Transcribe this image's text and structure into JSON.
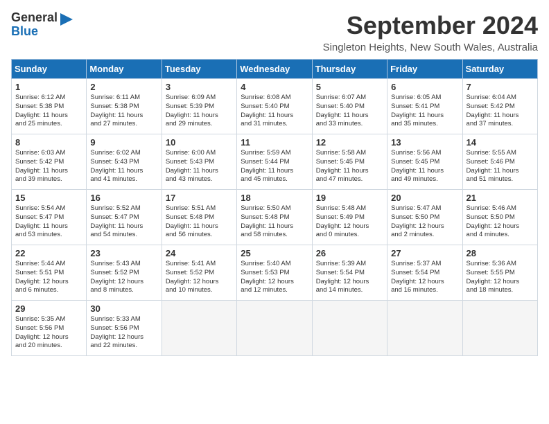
{
  "header": {
    "logo_line1": "General",
    "logo_line2": "Blue",
    "month": "September 2024",
    "location": "Singleton Heights, New South Wales, Australia"
  },
  "days_of_week": [
    "Sunday",
    "Monday",
    "Tuesday",
    "Wednesday",
    "Thursday",
    "Friday",
    "Saturday"
  ],
  "weeks": [
    [
      {
        "day": "1",
        "lines": [
          "Sunrise: 6:12 AM",
          "Sunset: 5:38 PM",
          "Daylight: 11 hours",
          "and 25 minutes."
        ]
      },
      {
        "day": "2",
        "lines": [
          "Sunrise: 6:11 AM",
          "Sunset: 5:38 PM",
          "Daylight: 11 hours",
          "and 27 minutes."
        ]
      },
      {
        "day": "3",
        "lines": [
          "Sunrise: 6:09 AM",
          "Sunset: 5:39 PM",
          "Daylight: 11 hours",
          "and 29 minutes."
        ]
      },
      {
        "day": "4",
        "lines": [
          "Sunrise: 6:08 AM",
          "Sunset: 5:40 PM",
          "Daylight: 11 hours",
          "and 31 minutes."
        ]
      },
      {
        "day": "5",
        "lines": [
          "Sunrise: 6:07 AM",
          "Sunset: 5:40 PM",
          "Daylight: 11 hours",
          "and 33 minutes."
        ]
      },
      {
        "day": "6",
        "lines": [
          "Sunrise: 6:05 AM",
          "Sunset: 5:41 PM",
          "Daylight: 11 hours",
          "and 35 minutes."
        ]
      },
      {
        "day": "7",
        "lines": [
          "Sunrise: 6:04 AM",
          "Sunset: 5:42 PM",
          "Daylight: 11 hours",
          "and 37 minutes."
        ]
      }
    ],
    [
      {
        "day": "8",
        "lines": [
          "Sunrise: 6:03 AM",
          "Sunset: 5:42 PM",
          "Daylight: 11 hours",
          "and 39 minutes."
        ]
      },
      {
        "day": "9",
        "lines": [
          "Sunrise: 6:02 AM",
          "Sunset: 5:43 PM",
          "Daylight: 11 hours",
          "and 41 minutes."
        ]
      },
      {
        "day": "10",
        "lines": [
          "Sunrise: 6:00 AM",
          "Sunset: 5:43 PM",
          "Daylight: 11 hours",
          "and 43 minutes."
        ]
      },
      {
        "day": "11",
        "lines": [
          "Sunrise: 5:59 AM",
          "Sunset: 5:44 PM",
          "Daylight: 11 hours",
          "and 45 minutes."
        ]
      },
      {
        "day": "12",
        "lines": [
          "Sunrise: 5:58 AM",
          "Sunset: 5:45 PM",
          "Daylight: 11 hours",
          "and 47 minutes."
        ]
      },
      {
        "day": "13",
        "lines": [
          "Sunrise: 5:56 AM",
          "Sunset: 5:45 PM",
          "Daylight: 11 hours",
          "and 49 minutes."
        ]
      },
      {
        "day": "14",
        "lines": [
          "Sunrise: 5:55 AM",
          "Sunset: 5:46 PM",
          "Daylight: 11 hours",
          "and 51 minutes."
        ]
      }
    ],
    [
      {
        "day": "15",
        "lines": [
          "Sunrise: 5:54 AM",
          "Sunset: 5:47 PM",
          "Daylight: 11 hours",
          "and 53 minutes."
        ]
      },
      {
        "day": "16",
        "lines": [
          "Sunrise: 5:52 AM",
          "Sunset: 5:47 PM",
          "Daylight: 11 hours",
          "and 54 minutes."
        ]
      },
      {
        "day": "17",
        "lines": [
          "Sunrise: 5:51 AM",
          "Sunset: 5:48 PM",
          "Daylight: 11 hours",
          "and 56 minutes."
        ]
      },
      {
        "day": "18",
        "lines": [
          "Sunrise: 5:50 AM",
          "Sunset: 5:48 PM",
          "Daylight: 11 hours",
          "and 58 minutes."
        ]
      },
      {
        "day": "19",
        "lines": [
          "Sunrise: 5:48 AM",
          "Sunset: 5:49 PM",
          "Daylight: 12 hours",
          "and 0 minutes."
        ]
      },
      {
        "day": "20",
        "lines": [
          "Sunrise: 5:47 AM",
          "Sunset: 5:50 PM",
          "Daylight: 12 hours",
          "and 2 minutes."
        ]
      },
      {
        "day": "21",
        "lines": [
          "Sunrise: 5:46 AM",
          "Sunset: 5:50 PM",
          "Daylight: 12 hours",
          "and 4 minutes."
        ]
      }
    ],
    [
      {
        "day": "22",
        "lines": [
          "Sunrise: 5:44 AM",
          "Sunset: 5:51 PM",
          "Daylight: 12 hours",
          "and 6 minutes."
        ]
      },
      {
        "day": "23",
        "lines": [
          "Sunrise: 5:43 AM",
          "Sunset: 5:52 PM",
          "Daylight: 12 hours",
          "and 8 minutes."
        ]
      },
      {
        "day": "24",
        "lines": [
          "Sunrise: 5:41 AM",
          "Sunset: 5:52 PM",
          "Daylight: 12 hours",
          "and 10 minutes."
        ]
      },
      {
        "day": "25",
        "lines": [
          "Sunrise: 5:40 AM",
          "Sunset: 5:53 PM",
          "Daylight: 12 hours",
          "and 12 minutes."
        ]
      },
      {
        "day": "26",
        "lines": [
          "Sunrise: 5:39 AM",
          "Sunset: 5:54 PM",
          "Daylight: 12 hours",
          "and 14 minutes."
        ]
      },
      {
        "day": "27",
        "lines": [
          "Sunrise: 5:37 AM",
          "Sunset: 5:54 PM",
          "Daylight: 12 hours",
          "and 16 minutes."
        ]
      },
      {
        "day": "28",
        "lines": [
          "Sunrise: 5:36 AM",
          "Sunset: 5:55 PM",
          "Daylight: 12 hours",
          "and 18 minutes."
        ]
      }
    ],
    [
      {
        "day": "29",
        "lines": [
          "Sunrise: 5:35 AM",
          "Sunset: 5:56 PM",
          "Daylight: 12 hours",
          "and 20 minutes."
        ]
      },
      {
        "day": "30",
        "lines": [
          "Sunrise: 5:33 AM",
          "Sunset: 5:56 PM",
          "Daylight: 12 hours",
          "and 22 minutes."
        ]
      },
      {
        "day": "",
        "lines": []
      },
      {
        "day": "",
        "lines": []
      },
      {
        "day": "",
        "lines": []
      },
      {
        "day": "",
        "lines": []
      },
      {
        "day": "",
        "lines": []
      }
    ]
  ]
}
